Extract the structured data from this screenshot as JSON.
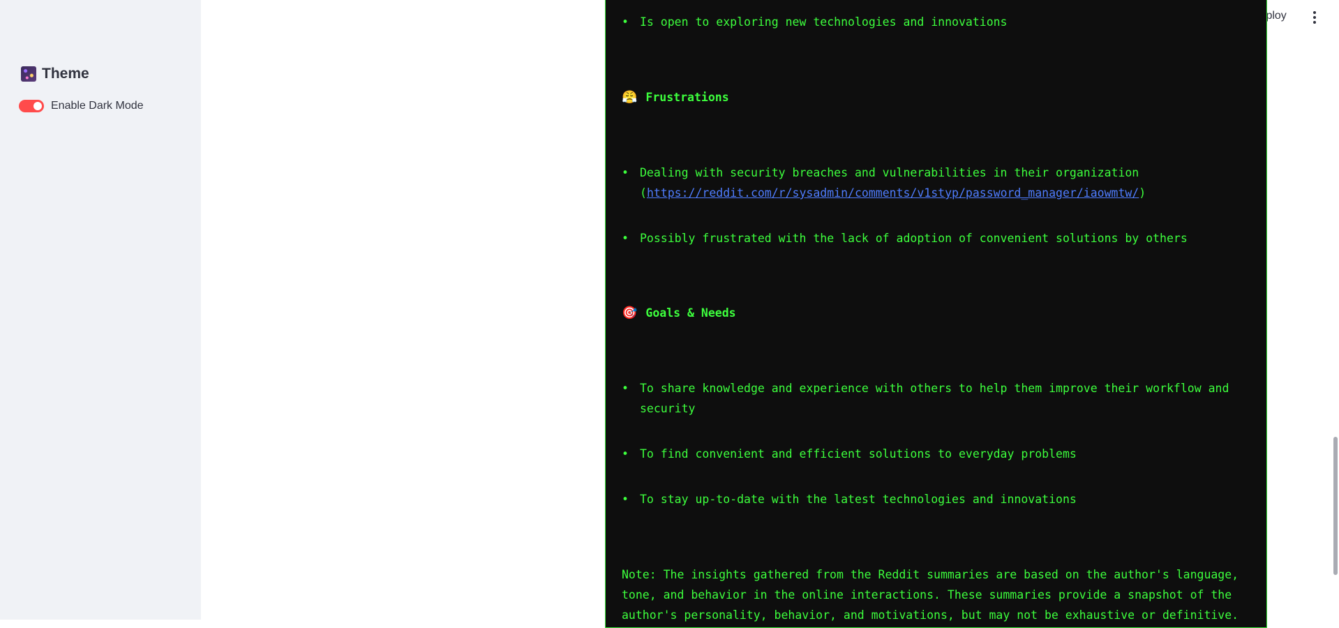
{
  "sidebar": {
    "theme_heading": "Theme",
    "dark_mode_label": "Enable Dark Mode",
    "dark_mode_enabled": true
  },
  "header": {
    "deploy_label": "Deploy"
  },
  "content": {
    "bullets_top": [
      "Is open to exploring new technologies and innovations"
    ],
    "frustrations_title": "Frustrations",
    "frustrations": {
      "item1_text": "Dealing with security breaches and vulnerabilities in their organization",
      "item1_link_open": "(",
      "item1_link": "https://reddit.com/r/sysadmin/comments/v1styp/password_manager/iaowmtw/",
      "item1_link_close": ")",
      "item2_text": "Possibly frustrated with the lack of adoption of convenient solutions by others"
    },
    "goals_title": "Goals & Needs",
    "goals": [
      "To share knowledge and experience with others to help them improve their workflow and security",
      "To find convenient and efficient solutions to everyday problems",
      "To stay up-to-date with the latest technologies and innovations"
    ],
    "note": "Note: The insights gathered from the Reddit summaries are based on the author's language, tone, and behavior in the online interactions. These summaries provide a snapshot of the author's personality, behavior, and motivations, but may not be exhaustive or definitive."
  },
  "colors": {
    "terminal_bg": "#0e0e0e",
    "terminal_text": "#3dff3d",
    "link": "#4f7dff",
    "toggle_on": "#ff4b4b",
    "sidebar_bg": "#f0f2f6"
  },
  "icons": {
    "theme": "theme-palette-icon",
    "frustrations": "frustrated-face-icon",
    "goals": "target-icon"
  }
}
